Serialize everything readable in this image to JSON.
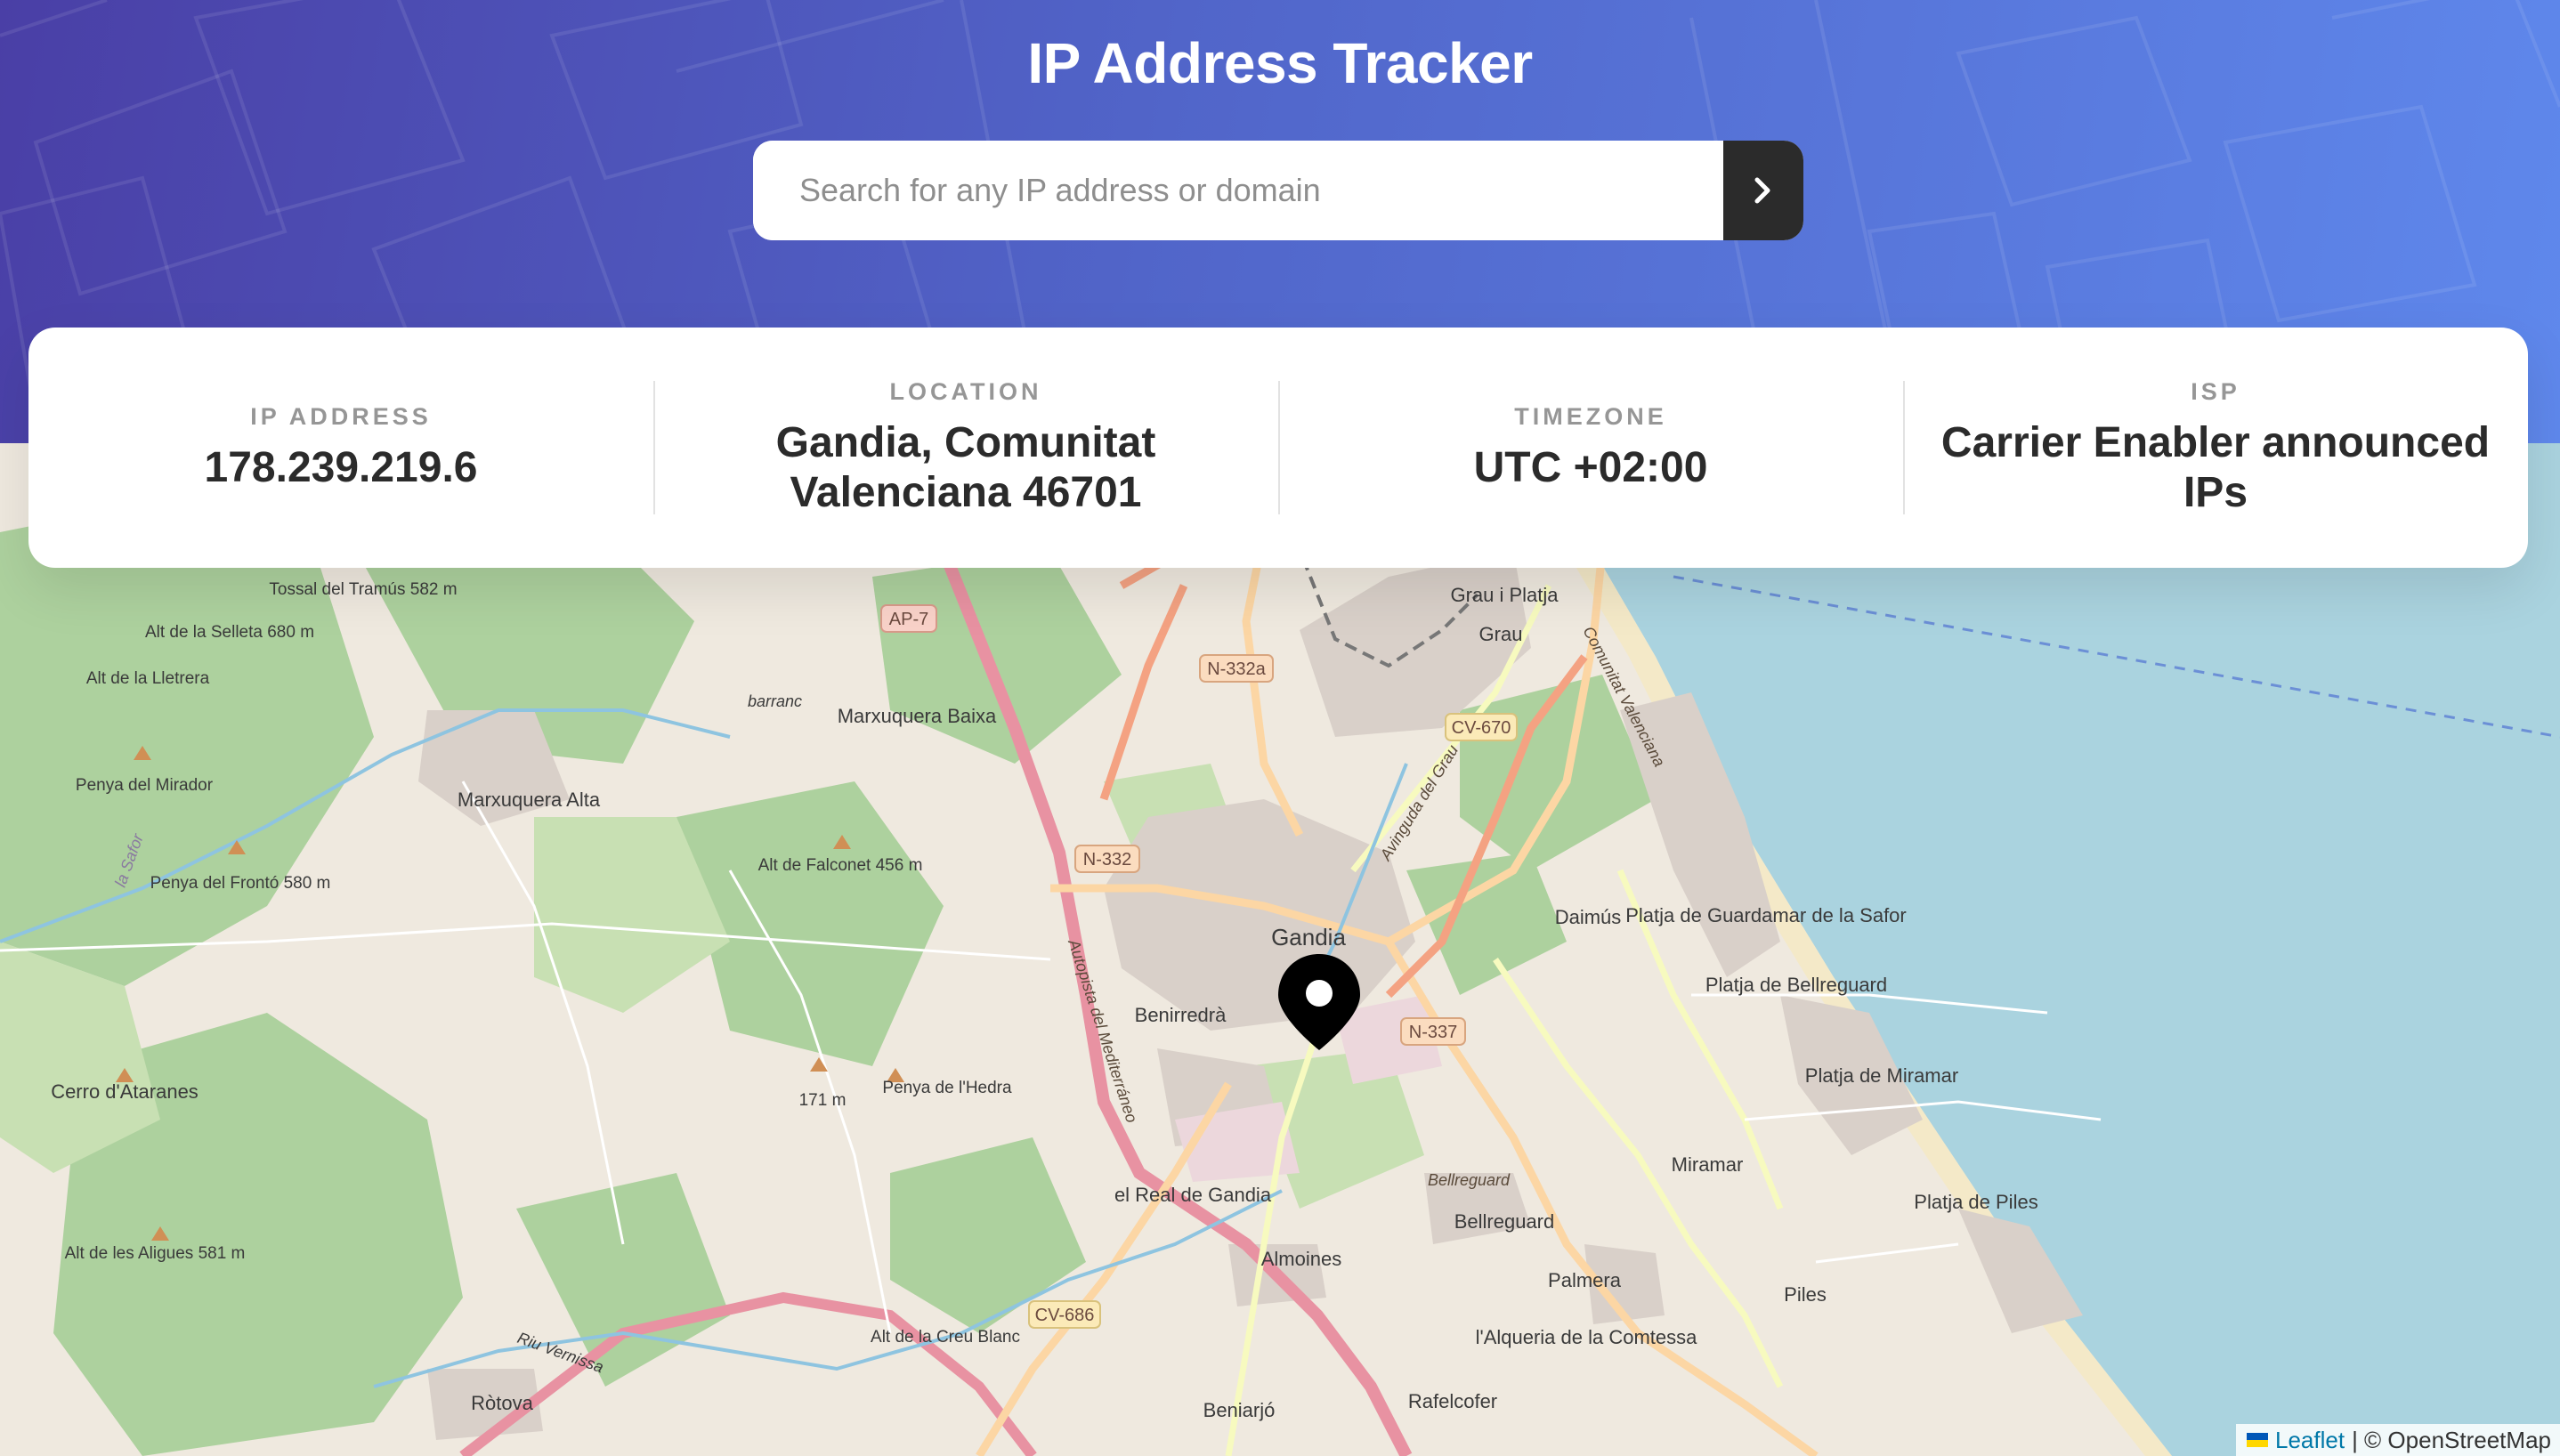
{
  "header": {
    "title": "IP Address Tracker",
    "search": {
      "placeholder": "Search for any IP address or domain",
      "value": "",
      "button_icon": "chevron-right-icon"
    }
  },
  "info": [
    {
      "label": "IP ADDRESS",
      "value": "178.239.219.6"
    },
    {
      "label": "LOCATION",
      "value": "Gandia, Comunitat Valenciana 46701"
    },
    {
      "label": "TIMEZONE",
      "value": "UTC +02:00"
    },
    {
      "label": "ISP",
      "value": "Carrier Enabler announced IPs"
    }
  ],
  "map": {
    "marker_icon": "location-pin-icon",
    "labels": {
      "gandia": "Gandia",
      "benirredra": "Benirredrà",
      "marxuquera_baixa": "Marxuquera Baixa",
      "marxuquera_alta": "Marxuquera Alta",
      "grau": "Grau",
      "grau_platja": "Grau i Platja",
      "daimus": "Daimús",
      "guardamar": "Platja de Guardamar de la Safor",
      "bellreguard_platja": "Platja de Bellreguard",
      "miramar_platja": "Platja de Miramar",
      "miramar": "Miramar",
      "piles_platja": "Platja de Piles",
      "piles": "Piles",
      "bellreguard": "Bellreguard",
      "almoines": "Almoines",
      "palmera": "Palmera",
      "real": "el Real de Gandia",
      "alqueria": "l'Alqueria de la Comtessa",
      "rafelcofer": "Rafelcofer",
      "beniarjo": "Beniarjó",
      "rotova": "Ròtova",
      "cerro": "Cerro d'Ataranes",
      "penya_mirador": "Penya del Mirador",
      "penya_fronto": "Penya del Frontó 580 m",
      "falconet": "Alt de Falconet 456 m",
      "tossal": "Tossal del Tramús 582 m",
      "selleta": "Alt de la Selleta 680 m",
      "lletrera": "Alt de la Lletrera",
      "aligues": "Alt de les Aligues 581 m",
      "hedra": "Penya de l'Hedra",
      "h171": "171 m",
      "creu": "Alt de la Creu Blanc",
      "la_safor": "la Safor",
      "barranc": "barranc",
      "riu_vernisso": "Riu Vernissa",
      "autopista": "Autopista del Mediterráneo",
      "av_grau": "Avinguda del Grau",
      "bellreguard_italic": "Bellreguard",
      "comunitat": "Comunitat Valenciana",
      "r_ap7": "AP-7",
      "r_n332a": "N-332a",
      "r_cv670": "CV-670",
      "r_n332": "N-332",
      "r_n337": "N-337",
      "r_cv686": "CV-686"
    }
  },
  "attribution": {
    "leaflet": "Leaflet",
    "osm": "| © OpenStreetMap"
  }
}
